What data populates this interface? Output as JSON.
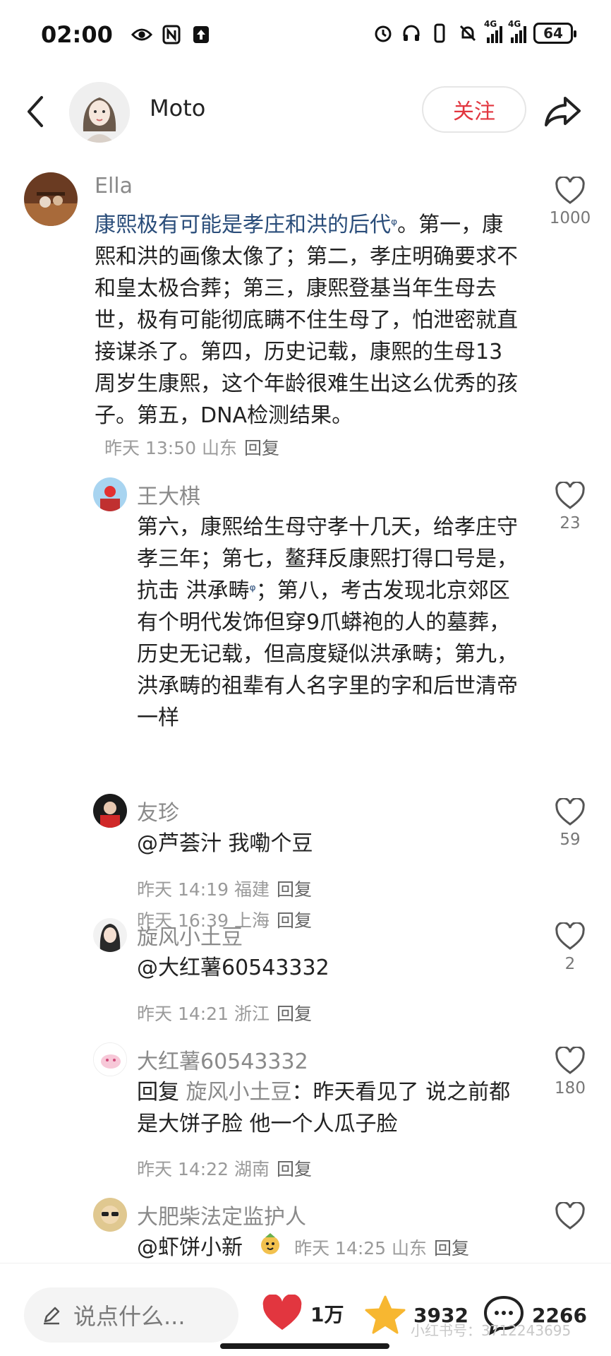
{
  "status_bar": {
    "time": "02:00",
    "signal_labels": [
      "4G",
      "4G"
    ],
    "battery": "64",
    "icons_left": [
      "eye-icon",
      "nfc-icon",
      "upload-icon"
    ],
    "icons_right": [
      "alarm-icon",
      "headset-icon",
      "vibrate-icon",
      "mute-bell-icon"
    ]
  },
  "header": {
    "author": "Moto",
    "follow_label": "关注"
  },
  "comments": [
    {
      "name": "Ella",
      "text_main": "康熙极有可能是孝庄和洪的后代",
      "search_mark": "ᵠ",
      "text_rest": "。第一，康熙和洪的画像太像了；第二，孝庄明确要求不和皇太极合葬；第三，康熙登基当年生母去世，极有可能彻底瞒不住生母了，怕泄密就直接谋杀了。第四，历史记载，康熙的生母13周岁生康熙，这个年龄很难生出这么优秀的孩子。第五，DNA检测结果。",
      "time": "昨天 13:50 山东",
      "reply_label": "回复",
      "likes": "1000"
    },
    {
      "name": "王大棋",
      "text_main": "第六，康熙给生母守孝十几天，给孝庄守孝三年；第七，鳌拜反康熙打得口号是，抗击 洪承畴",
      "search_mark": "ᵠ",
      "text_rest": "；第八，考古发现北京郊区有个明代发饰但穿9爪蟒袍的人的墓葬，历史无记载，但高度疑似洪承畴；第九，洪承畴的祖辈有人名字里的字和后世清帝一样",
      "time": "昨天 16:39 上海",
      "reply_label": "回复",
      "likes": "23"
    },
    {
      "name": "友珍",
      "text": "@芦荟汁  我嘞个豆",
      "time": "昨天 14:19 福建",
      "reply_label": "回复",
      "likes": "59"
    },
    {
      "name": "旋风小土豆",
      "text": "@大红薯60543332",
      "time": "昨天 14:21 浙江",
      "reply_label": "回复",
      "likes": "2"
    },
    {
      "name": "大红薯60543332",
      "reply_prefix": "回复",
      "reply_target": "旋风小土豆",
      "text": "：昨天看见了 说之前都是大饼子脸 他一个人瓜子脸",
      "time": "昨天 14:22 湖南",
      "reply_label": "回复",
      "likes": "180"
    },
    {
      "name": "大肥柴法定监护人",
      "text": "@虾饼小新",
      "time": "昨天 14:25 山东",
      "reply_label": "回复",
      "likes": ""
    }
  ],
  "bottom_bar": {
    "input_placeholder": "说点什么...",
    "likes": "1万",
    "collects": "3932",
    "comments": "2266",
    "watermark": "小红书号：3712243695"
  },
  "colors": {
    "accent_red": "#e2363f",
    "star_yellow": "#f7b731",
    "text_gray": "#8a8a8a"
  }
}
